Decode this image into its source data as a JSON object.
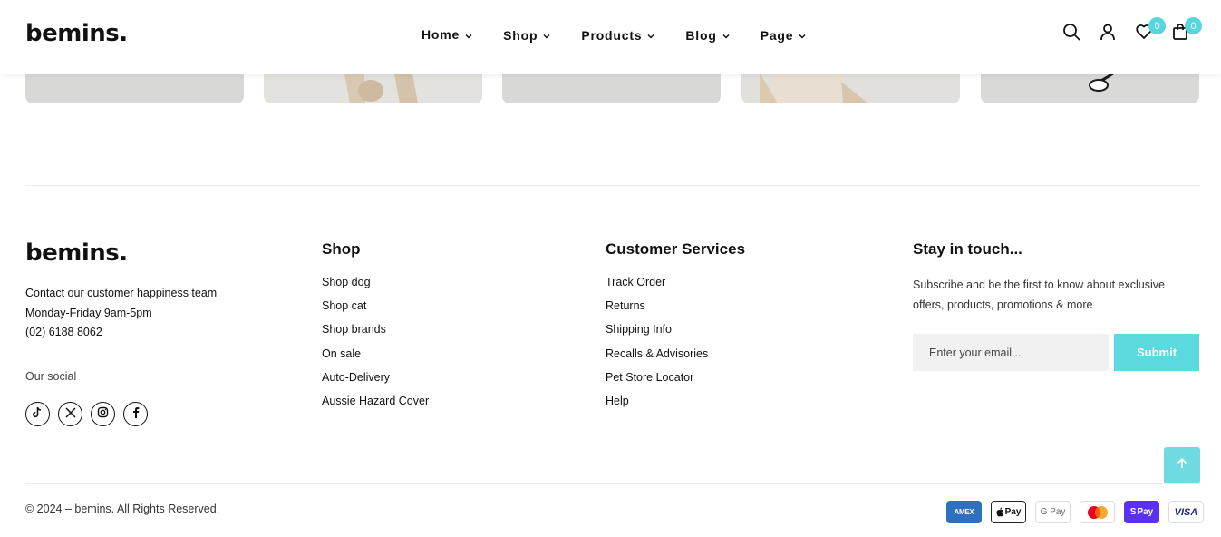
{
  "header": {
    "logo": "bemins.",
    "nav": [
      {
        "label": "Home"
      },
      {
        "label": "Shop"
      },
      {
        "label": "Products"
      },
      {
        "label": "Blog"
      },
      {
        "label": "Page"
      }
    ],
    "wishlist_count": "0",
    "cart_count": "0"
  },
  "footer": {
    "logo": "bemins.",
    "contact": {
      "line1": "Contact our customer happiness team",
      "line2": "Monday-Friday 9am-5pm",
      "phone": "(02) 6188 8062"
    },
    "social_label": "Our social",
    "socials": [
      "tiktok-icon",
      "x-icon",
      "instagram-icon",
      "facebook-icon"
    ],
    "shop": {
      "title": "Shop",
      "links": [
        "Shop dog",
        "Shop cat",
        "Shop brands",
        "On sale",
        "Auto-Delivery",
        "Aussie Hazard Cover"
      ]
    },
    "services": {
      "title": "Customer Services",
      "links": [
        "Track Order",
        "Returns",
        "Shipping Info",
        "Recalls & Advisories",
        "Pet Store Locator",
        "Help"
      ]
    },
    "newsletter": {
      "title": "Stay in touch...",
      "text": "Subscribe and be the first to know about exclusive offers, products, promotions & more",
      "placeholder": "Enter your email...",
      "submit": "Submit"
    },
    "copyright": "© 2024 – bemins. All Rights Reserved.",
    "payments": [
      "AMEX",
      "Pay",
      "G Pay",
      "",
      "Pay",
      "VISA"
    ]
  },
  "colors": {
    "accent": "#56d6dd",
    "text": "#111111"
  }
}
